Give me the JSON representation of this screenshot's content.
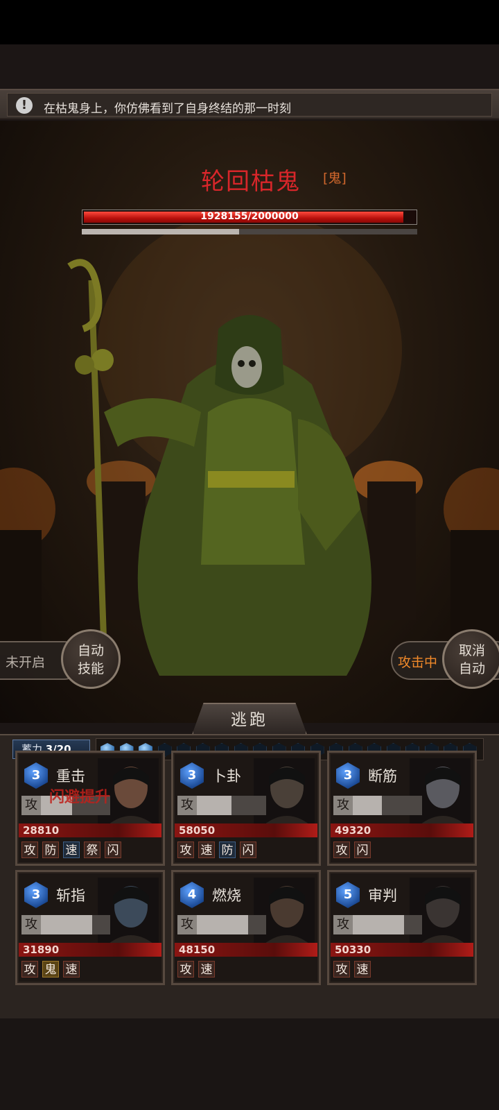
{
  "notice": {
    "text": "在枯鬼身上，你仿佛看到了自身终结的那一时刻",
    "icon": "exclamation-icon"
  },
  "boss": {
    "name": "轮回枯鬼",
    "tag": "[鬼]",
    "hp_text": "1928155/2000000",
    "hp_current": 1928155,
    "hp_max": 2000000,
    "sub_progress": 0.47
  },
  "controls": {
    "left_status": "未开启",
    "auto_skill_label": "自动\n技能",
    "right_status": "攻击中",
    "cancel_auto_label": "取消\n自动",
    "escape_label": "逃跑"
  },
  "charge": {
    "label": "蓄力",
    "value": "3/20",
    "current": 3,
    "max": 20
  },
  "characters": [
    {
      "level": "3",
      "skill": "重击",
      "power": "28810",
      "atk_label": "攻",
      "atk_fill": 0.45,
      "overlay": "闪避提升",
      "tags": [
        "攻",
        "防",
        "速",
        "祭",
        "闪"
      ],
      "tag_styles": [
        "red",
        "red",
        "blue",
        "red",
        "red"
      ]
    },
    {
      "level": "3",
      "skill": "卜卦",
      "power": "58050",
      "atk_label": "攻",
      "atk_fill": 0.5,
      "overlay": "",
      "tags": [
        "攻",
        "速",
        "防",
        "闪"
      ],
      "tag_styles": [
        "red",
        "red",
        "blue",
        "red"
      ]
    },
    {
      "level": "3",
      "skill": "断筋",
      "power": "49320",
      "atk_label": "攻",
      "atk_fill": 0.42,
      "overlay": "",
      "tags": [
        "攻",
        "闪"
      ],
      "tag_styles": [
        "red",
        "red"
      ]
    },
    {
      "level": "3",
      "skill": "斩指",
      "power": "31890",
      "atk_label": "攻",
      "atk_fill": 0.74,
      "overlay": "",
      "tags": [
        "攻",
        "鬼",
        "速"
      ],
      "tag_styles": [
        "red",
        "gold",
        "red"
      ]
    },
    {
      "level": "4",
      "skill": "燃烧",
      "power": "48150",
      "atk_label": "攻",
      "atk_fill": 0.74,
      "overlay": "",
      "tags": [
        "攻",
        "速"
      ],
      "tag_styles": [
        "red",
        "red"
      ]
    },
    {
      "level": "5",
      "skill": "审判",
      "power": "50330",
      "atk_label": "攻",
      "atk_fill": 0.74,
      "overlay": "",
      "tags": [
        "攻",
        "速"
      ],
      "tag_styles": [
        "red",
        "red"
      ]
    }
  ]
}
